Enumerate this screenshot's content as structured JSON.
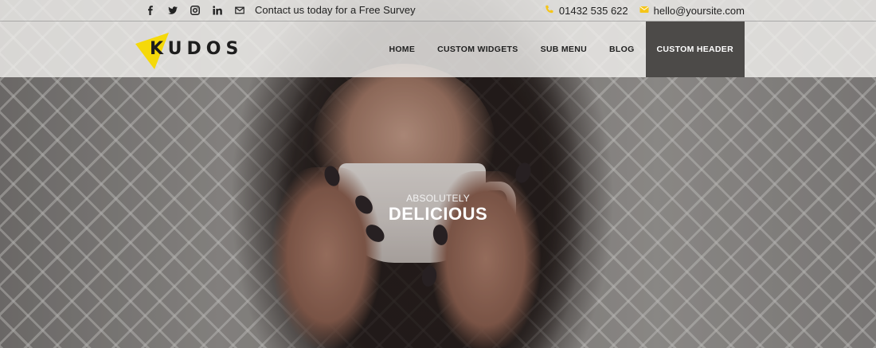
{
  "topbar": {
    "social_icons": [
      "facebook-icon",
      "twitter-icon",
      "instagram-icon",
      "linkedin-icon",
      "mail-icon"
    ],
    "contact_text": "Contact us today for a Free Survey",
    "phone": "01432 535 622",
    "email": "hello@yoursite.com",
    "accent_color": "#f5c518"
  },
  "header": {
    "logo_text": "KUDOS",
    "logo_color": "#f5d90a",
    "nav": [
      {
        "label": "HOME"
      },
      {
        "label": "CUSTOM WIDGETS"
      },
      {
        "label": "SUB MENU"
      },
      {
        "label": "BLOG"
      },
      {
        "label": "CUSTOM HEADER",
        "active": true
      }
    ],
    "active_bg": "#4c4a48"
  },
  "hero": {
    "kicker": "ABSOLUTELY",
    "title": "DELICIOUS"
  }
}
